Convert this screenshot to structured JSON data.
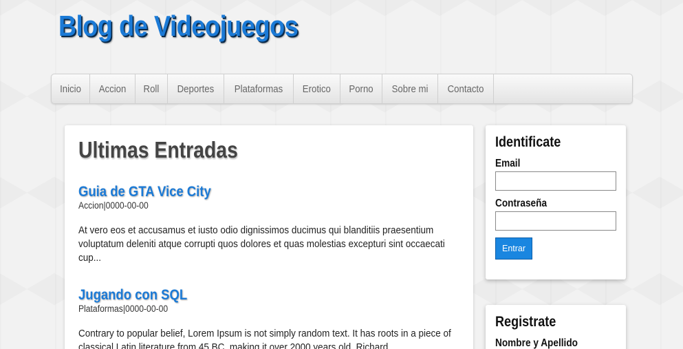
{
  "site": {
    "title": "Blog de Videojuegos"
  },
  "nav": {
    "items": [
      {
        "label": "Inicio"
      },
      {
        "label": "Accion"
      },
      {
        "label": "Roll"
      },
      {
        "label": "Deportes"
      },
      {
        "label": "Plataformas"
      },
      {
        "label": "Erotico"
      },
      {
        "label": "Porno"
      },
      {
        "label": "Sobre mi"
      },
      {
        "label": "Contacto"
      }
    ]
  },
  "main": {
    "heading": "Ultimas Entradas",
    "posts": [
      {
        "title": "Guia de GTA Vice City",
        "meta": "Accion|0000-00-00",
        "excerpt": "At vero eos et accusamus et iusto odio dignissimos ducimus qui blanditiis praesentium voluptatum deleniti atque corrupti quos dolores et quas molestias excepturi sint occaecati cup..."
      },
      {
        "title": "Jugando con SQL",
        "meta": "Plataformas|0000-00-00",
        "excerpt": "Contrary to popular belief, Lorem Ipsum is not simply random text. It has roots in a piece of classical Latin literature from 45 BC, making it over 2000 years old. Richard..."
      }
    ]
  },
  "login": {
    "title": "Identificate",
    "email_label": "Email",
    "email_value": "",
    "password_label": "Contraseña",
    "password_value": "",
    "submit_label": "Entrar"
  },
  "register": {
    "title": "Registrate",
    "name_label": "Nombre y Apellido"
  },
  "colors": {
    "accent": "#1b7ad6",
    "button": "#1a86e0"
  }
}
